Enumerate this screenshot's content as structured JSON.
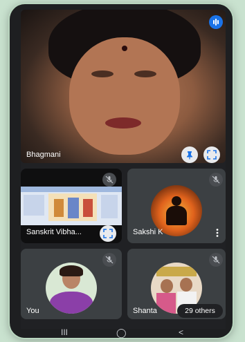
{
  "main_speaker": {
    "name": "Bhagmani"
  },
  "tiles": [
    {
      "name": "Sanskrit Vibha..."
    },
    {
      "name": "Sakshi K"
    },
    {
      "name": "You"
    },
    {
      "name": "Shanta"
    }
  ],
  "others_badge": {
    "label": "29 others"
  },
  "nav": {
    "recents": "III",
    "home": "◯",
    "back": "<"
  },
  "icons": {
    "audio_indicator": "audio-bars-icon",
    "pin": "pin-icon",
    "fullscreen": "fullscreen-icon",
    "mic_off": "mic-off-icon",
    "more": "more-vert-icon"
  },
  "colors": {
    "accent": "#1a73e8",
    "tile": "#3c4043",
    "background": "#202124"
  }
}
